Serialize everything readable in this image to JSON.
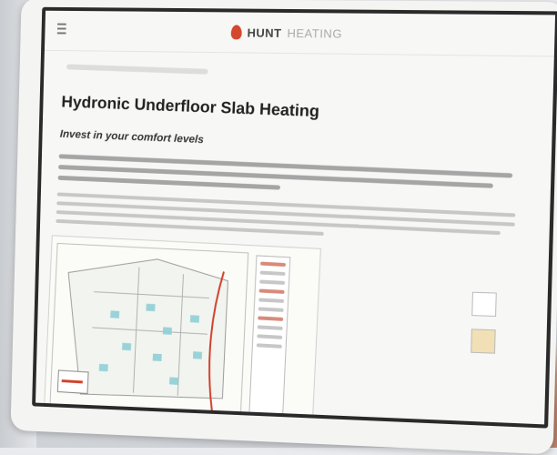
{
  "brand": {
    "name_strong": "HUNT",
    "name_light": "HEATING"
  },
  "page": {
    "title": "Hydronic Underfloor Slab Heating",
    "subtitle": "Invest in your comfort levels"
  },
  "icons": {
    "menu": "hamburger-icon",
    "logo_mark": "flame-icon"
  },
  "colors": {
    "logo_flame": "#d4472f",
    "page_bg": "#f7f7f5"
  }
}
